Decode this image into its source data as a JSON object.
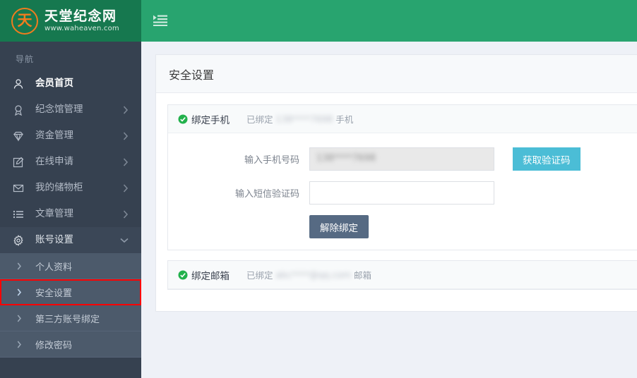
{
  "brand": {
    "logo_glyph": "天",
    "title": "天堂纪念网",
    "url": "www.waheaven.com"
  },
  "header": {
    "menu_toggle_icon": "list-indent-icon"
  },
  "sidebar": {
    "heading": "导航",
    "items": [
      {
        "label": "会员首页",
        "icon": "user-icon",
        "has_arrow": false,
        "state": "active"
      },
      {
        "label": "纪念馆管理",
        "icon": "medal-icon",
        "has_arrow": true,
        "state": ""
      },
      {
        "label": "资金管理",
        "icon": "diamond-icon",
        "has_arrow": true,
        "state": ""
      },
      {
        "label": "在线申请",
        "icon": "edit-square-icon",
        "has_arrow": true,
        "state": ""
      },
      {
        "label": "我的储物柜",
        "icon": "inbox-icon",
        "has_arrow": true,
        "state": ""
      },
      {
        "label": "文章管理",
        "icon": "list-icon",
        "has_arrow": true,
        "state": ""
      },
      {
        "label": "账号设置",
        "icon": "gear-icon",
        "has_arrow": true,
        "state": "open"
      }
    ],
    "submenu": [
      {
        "label": "个人资料",
        "selected": false
      },
      {
        "label": "安全设置",
        "selected": true
      },
      {
        "label": "第三方账号绑定",
        "selected": false
      },
      {
        "label": "修改密码",
        "selected": false
      }
    ]
  },
  "page": {
    "title": "安全设置"
  },
  "phone_panel": {
    "icon": "check-circle-icon",
    "title": "绑定手机",
    "status_prefix": "已绑定",
    "status_masked": "138****7698",
    "status_suffix": "手机",
    "phone_label": "输入手机号码",
    "phone_value_masked": "138****7698",
    "phone_placeholder": "",
    "code_label": "输入短信验证码",
    "code_value": "",
    "code_placeholder": "",
    "get_code_button": "获取验证码",
    "unbind_button": "解除绑定"
  },
  "email_panel": {
    "icon": "check-circle-icon",
    "title": "绑定邮箱",
    "status_prefix": "已绑定",
    "status_masked": "abc****@qq.com",
    "status_suffix": "邮箱"
  },
  "colors": {
    "header_green": "#28a46f",
    "logo_green": "#16784f",
    "logo_orange": "#f07c1e",
    "sidebar_dark": "#364150",
    "submenu": "#4c5a6b",
    "accent_cyan": "#4bbdd6",
    "unbind_slate": "#566a83",
    "check_green": "#22b14c",
    "select_outline": "#ff0000"
  }
}
